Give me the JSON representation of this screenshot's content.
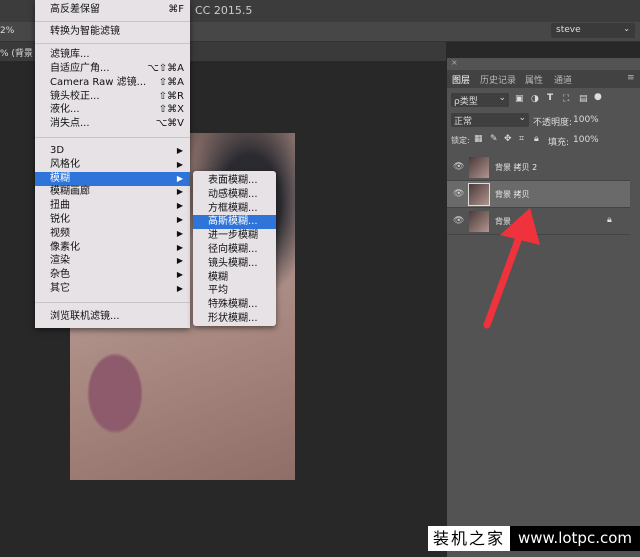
{
  "window": {
    "title": "CC 2015.5",
    "zoom": "2%",
    "workspace": "steve",
    "doc_tab": "% (背景 拷"
  },
  "menu": {
    "top": [
      {
        "label": "高反差保留",
        "shortcut": "⌘F"
      },
      {
        "label": "转换为智能滤镜",
        "shortcut": ""
      }
    ],
    "group2": [
      {
        "label": "滤镜库...",
        "shortcut": ""
      },
      {
        "label": "自适应广角...",
        "shortcut": "⌥⇧⌘A"
      },
      {
        "label": "Camera Raw 滤镜...",
        "shortcut": "⇧⌘A"
      },
      {
        "label": "镜头校正...",
        "shortcut": "⇧⌘R"
      },
      {
        "label": "液化...",
        "shortcut": "⇧⌘X"
      },
      {
        "label": "消失点...",
        "shortcut": "⌥⌘V"
      }
    ],
    "group3": [
      "3D",
      "风格化",
      "模糊",
      "模糊画廊",
      "扭曲",
      "锐化",
      "视频",
      "像素化",
      "渲染",
      "杂色",
      "其它"
    ],
    "highlighted": "模糊",
    "browse": "浏览联机滤镜...",
    "arrow": "▶"
  },
  "submenu": {
    "items": [
      "表面模糊...",
      "动感模糊...",
      "方框模糊...",
      "高斯模糊...",
      "进一步模糊",
      "径向模糊...",
      "镜头模糊...",
      "模糊",
      "平均",
      "特殊模糊...",
      "形状模糊..."
    ],
    "highlighted": "高斯模糊..."
  },
  "layers_panel": {
    "tabs": [
      "图层",
      "历史记录",
      "属性",
      "通道"
    ],
    "filter": "ρ类型",
    "blend_mode": "正常",
    "opacity_label": "不透明度:",
    "opacity": "100%",
    "lock_label": "锁定:",
    "fill_label": "填充:",
    "fill": "100%",
    "layers": [
      {
        "name": "背景 拷贝 2",
        "selected": false
      },
      {
        "name": "背景 拷贝",
        "selected": true
      },
      {
        "name": "背景",
        "selected": false,
        "locked": true
      }
    ]
  },
  "annotation": {
    "color": "#f0323c"
  },
  "watermark": {
    "cn": "装机之家",
    "url": "www.lotpc.com"
  }
}
